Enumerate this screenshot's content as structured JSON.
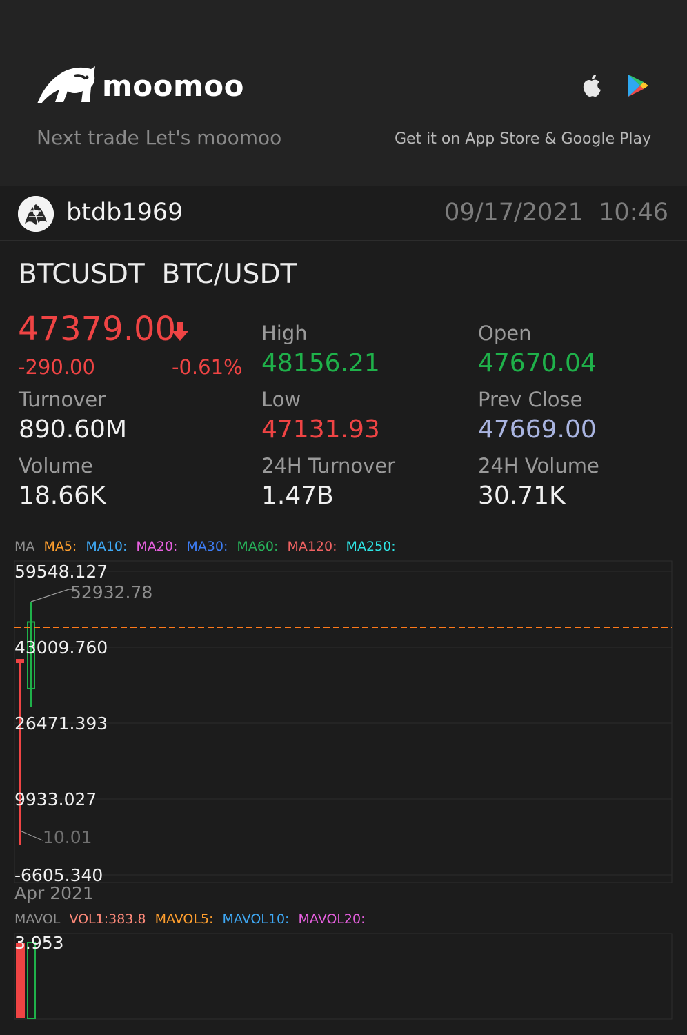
{
  "header": {
    "brand": "moomoo",
    "tagline": "Next trade Let's moomoo",
    "store_text": "Get it on App Store & Google Play",
    "icons": [
      "bull-logo-icon",
      "apple-icon",
      "google-play-icon"
    ]
  },
  "user": {
    "name": "btdb1969",
    "datetime": "09/17/2021  10:46"
  },
  "stock": {
    "symbol": "BTCUSDT  BTC/USDT",
    "price": "47379.00",
    "change": "-290.00",
    "change_pct": "-0.61%",
    "direction": "down",
    "stats": {
      "high_label": "High",
      "high": "48156.21",
      "open_label": "Open",
      "open": "47670.04",
      "turnover_label": "Turnover",
      "turnover": "890.60M",
      "low_label": "Low",
      "low": "47131.93",
      "prev_close_label": "Prev Close",
      "prev_close": "47669.00",
      "volume_label": "Volume",
      "volume": "18.66K",
      "turnover24_label": "24H Turnover",
      "turnover24": "1.47B",
      "volume24_label": "24H Volume",
      "volume24": "30.71K"
    }
  },
  "ma_legend": {
    "ma": "MA",
    "ma5": "MA5:",
    "ma10": "MA10:",
    "ma20": "MA20:",
    "ma30": "MA30:",
    "ma60": "MA60:",
    "ma120": "MA120:",
    "ma250": "MA250:"
  },
  "chart": {
    "y_labels": [
      "59548.127",
      "43009.760",
      "26471.393",
      "9933.027",
      "-6605.340"
    ],
    "max_label": "52932.78",
    "min_label": "10.01",
    "date_label": "Apr 2021"
  },
  "mavol_legend": {
    "mavol": "MAVOL",
    "vol1": "VOL1:383.8",
    "mavol5": "MAVOL5:",
    "mavol10": "MAVOL10:",
    "mavol20": "MAVOL20:"
  },
  "vol_chart": {
    "y_label": "3.953"
  },
  "colors": {
    "up": "#1fb14a",
    "down": "#ef4444",
    "prev_close": "#a9b4e0",
    "ma5": "#ff9f2e",
    "ma10": "#3fa9f5",
    "ma20": "#e860e0",
    "ma30": "#3d7df5",
    "ma60": "#27b35a",
    "ma120": "#f06262",
    "ma250": "#2ee6e6",
    "price_line": "#ff7a1a"
  },
  "chart_data": {
    "type": "candlestick",
    "date_label": "Apr 2021",
    "ylim": [
      -6605.34,
      59548.127
    ],
    "y_ticks": [
      59548.127,
      43009.76,
      26471.393,
      9933.027,
      -6605.34
    ],
    "current_price_line": 47379.0,
    "candles": [
      {
        "open": 40000,
        "close": 40000,
        "high": 40000,
        "low": 10.01,
        "direction": "down"
      },
      {
        "open": 34000,
        "close": 48500,
        "high": 52932.78,
        "low": 30000,
        "direction": "up"
      }
    ],
    "annotations": {
      "max": "52932.78",
      "min": "10.01"
    },
    "volume": {
      "y_label": 3.953,
      "bars": [
        {
          "value": 3.953,
          "direction": "down"
        },
        {
          "value": 3.953,
          "direction": "up"
        }
      ]
    }
  }
}
